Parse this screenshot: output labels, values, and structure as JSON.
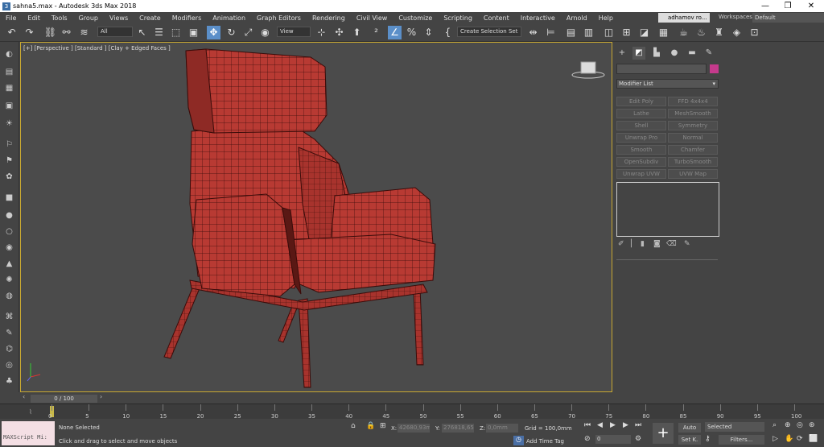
{
  "window": {
    "title": "sahna5.max - Autodesk 3ds Max 2018",
    "minimize": "—",
    "maximize": "❐",
    "close": "✕"
  },
  "menu": [
    "File",
    "Edit",
    "Tools",
    "Group",
    "Views",
    "Create",
    "Modifiers",
    "Animation",
    "Graph Editors",
    "Rendering",
    "Civil View",
    "Customize",
    "Scripting",
    "Content",
    "Interactive",
    "Arnold",
    "Help"
  ],
  "user": {
    "name": "adhamov ro...",
    "workspaces_label": "Workspaces:",
    "workspace": "Default"
  },
  "toolbar": {
    "filter": "All",
    "ref_coord": "View",
    "selection_set": "Create Selection Set"
  },
  "viewport": {
    "label": "[+] [Perspective ] [Standard ] [Clay + Edged Faces ]"
  },
  "command_panel": {
    "modifier_list": "Modifier List",
    "modifier_buttons": [
      "Edit Poly",
      "FFD 4x4x4",
      "Lathe",
      "MeshSmooth",
      "Shell",
      "Symmetry",
      "Unwrap Pro",
      "Normal",
      "Smooth",
      "Chamfer",
      "OpenSubdiv",
      "TurboSmooth",
      "Unwrap UVW",
      "UVW Map"
    ],
    "colors": {
      "object_color": "#c53a8c"
    }
  },
  "timeline": {
    "frame_label": "0 / 100",
    "ticks": [
      "0",
      "5",
      "10",
      "15",
      "20",
      "25",
      "30",
      "35",
      "40",
      "45",
      "50",
      "55",
      "60",
      "65",
      "70",
      "75",
      "80",
      "85",
      "90",
      "95",
      "100"
    ]
  },
  "status": {
    "maxscript": "MAXScript Mi:",
    "selection": "None Selected",
    "prompt": "Click and drag to select and move objects",
    "x_label": "X:",
    "x": "42680,93mm",
    "y_label": "Y:",
    "y": "276818,658",
    "z_label": "Z:",
    "z": "0,0mm",
    "grid": "Grid = 100,0mm",
    "add_time_tag": "Add Time Tag",
    "auto": "Auto",
    "set_key": "Set K.",
    "selected": "Selected",
    "filters": "Filters...",
    "frame": "0"
  },
  "model": {
    "colors": {
      "seat": "#b83a33",
      "dark": "#6a1f1b",
      "wire": "#3a0c0a"
    }
  }
}
